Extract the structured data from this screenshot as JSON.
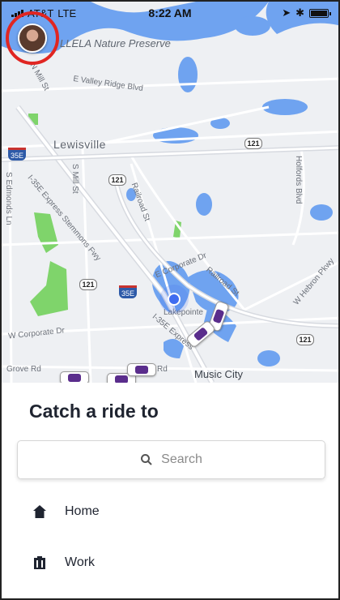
{
  "status_bar": {
    "carrier": "AT&T",
    "network": "LTE",
    "time": "8:22 AM"
  },
  "map": {
    "labels": {
      "preserve": "LLELA Nature Preserve",
      "city": "Lewisville",
      "music_city": "Music City",
      "valley_ridge": "E Valley Ridge Blvd",
      "mill_st": "S Mill St",
      "railroad_st": "Railroad St",
      "corporate_dr_e": "E Corporate Dr",
      "corporate_dr_w": "W Corporate Dr",
      "lakepointe": "Lakepointe",
      "i35e_express": "I-35E Express",
      "stemmons": "I-35E Express Stemmons Fwy",
      "railroad_st_2": "Railroad St",
      "hebron": "W Hebron Pkwy",
      "holfords": "Holfords Blvd",
      "grove_rd": "Grove Rd",
      "edmonds": "S Edmonds Ln",
      "n_mill": "N Mill St",
      "rd": "Rd"
    },
    "shields": {
      "hw121_top": "121",
      "hw121_mid": "121",
      "hw121_left": "121",
      "hw121_right": "121",
      "i35e_top": "35E",
      "i35e_mid": "35E"
    }
  },
  "sheet": {
    "title": "Catch a ride to",
    "search_placeholder": "Search",
    "shortcuts": [
      {
        "label": "Home",
        "icon": "home-icon"
      },
      {
        "label": "Work",
        "icon": "briefcase-icon"
      }
    ]
  },
  "colors": {
    "water": "#6fa3f0",
    "park": "#7fd46b",
    "accent_red": "#e02622",
    "car_purple": "#5a2d8c",
    "location_blue": "#3f6cf0"
  }
}
